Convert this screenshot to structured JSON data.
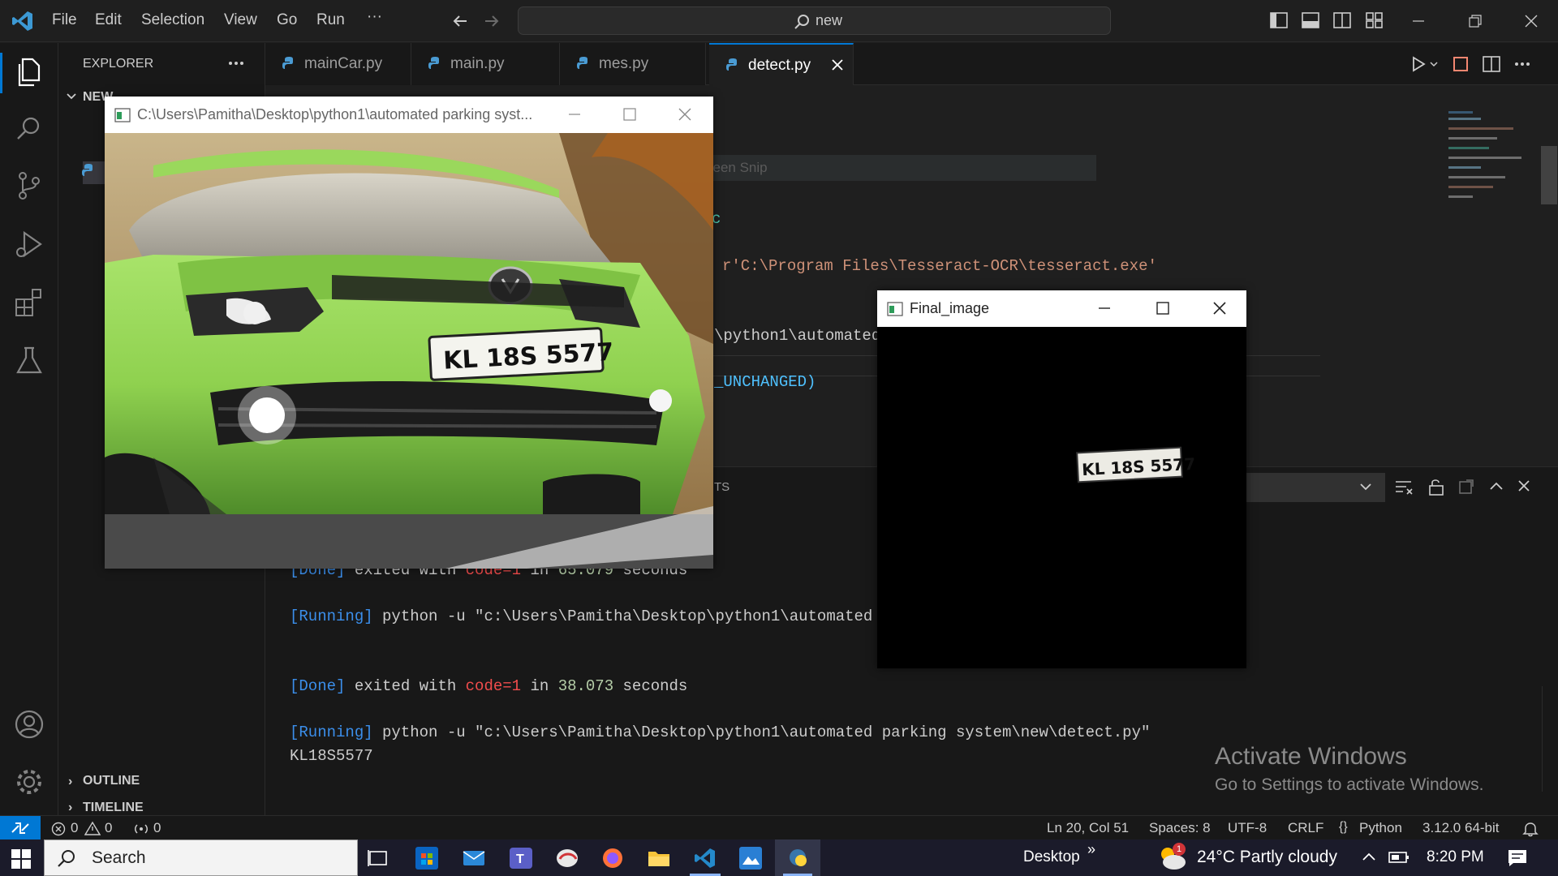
{
  "titlebar": {
    "menu": [
      "File",
      "Edit",
      "Selection",
      "View",
      "Go",
      "Run",
      "···"
    ],
    "search_text": "new"
  },
  "sidebar": {
    "header": "EXPLORER",
    "folder": "NEW",
    "outline": "OUTLINE",
    "timeline": "TIMELINE"
  },
  "tabs": [
    {
      "label": "mainCar.py",
      "active": false
    },
    {
      "label": "main.py",
      "active": false
    },
    {
      "label": "mes.py",
      "active": false
    },
    {
      "label": "detect.py",
      "active": true
    }
  ],
  "editor": {
    "lines": [
      {
        "text": "c"
      },
      {
        "text": "r'C:\\Program Files\\Tesseract-OCR\\tesseract.exe'"
      },
      {
        "text": "\\python1\\automated"
      },
      {
        "text": "_UNCHANGED)"
      }
    ],
    "screen_snip": "Screen Snip"
  },
  "panel": {
    "tab_fragment": "TS",
    "done1": {
      "tag": "[Done]",
      "a": " exited with ",
      "code": "code=1",
      "b": " in ",
      "secs": "65.079",
      "c": " seconds"
    },
    "run1": {
      "tag": "[Running]",
      "cmd": " python -u \"c:\\Users\\Pamitha\\Desktop\\python1\\automated"
    },
    "done2": {
      "tag": "[Done]",
      "a": " exited with ",
      "code": "code=1",
      "b": " in ",
      "secs": "38.073",
      "c": " seconds"
    },
    "run2": {
      "tag": "[Running]",
      "cmd": " python -u \"c:\\Users\\Pamitha\\Desktop\\python1\\automated parking system\\new\\detect.py\""
    },
    "output": "KL18S5577"
  },
  "status": {
    "errors": "0",
    "warnings": "0",
    "ports": "0",
    "position": "Ln 20, Col 51",
    "spaces": "Spaces: 8",
    "encoding": "UTF-8",
    "eol": "CRLF",
    "language": "Python",
    "interpreter": "3.12.0 64-bit"
  },
  "watermark": {
    "title": "Activate Windows",
    "subtitle": "Go to Settings to activate Windows."
  },
  "car_window": {
    "title": "C:\\Users\\Pamitha\\Desktop\\python1\\automated parking syst...",
    "plate_text": "KL  18S  5577"
  },
  "final_window": {
    "title": "Final_image",
    "plate_text": "KL 18S 5577"
  },
  "taskbar": {
    "search_placeholder": "Search",
    "desktop": "Desktop",
    "weather": "24°C  Partly cloudy",
    "weather_badge": "1",
    "time": "8:20 PM"
  },
  "colors": {
    "accent": "#0078d4",
    "car_green": "#8fd14f"
  }
}
